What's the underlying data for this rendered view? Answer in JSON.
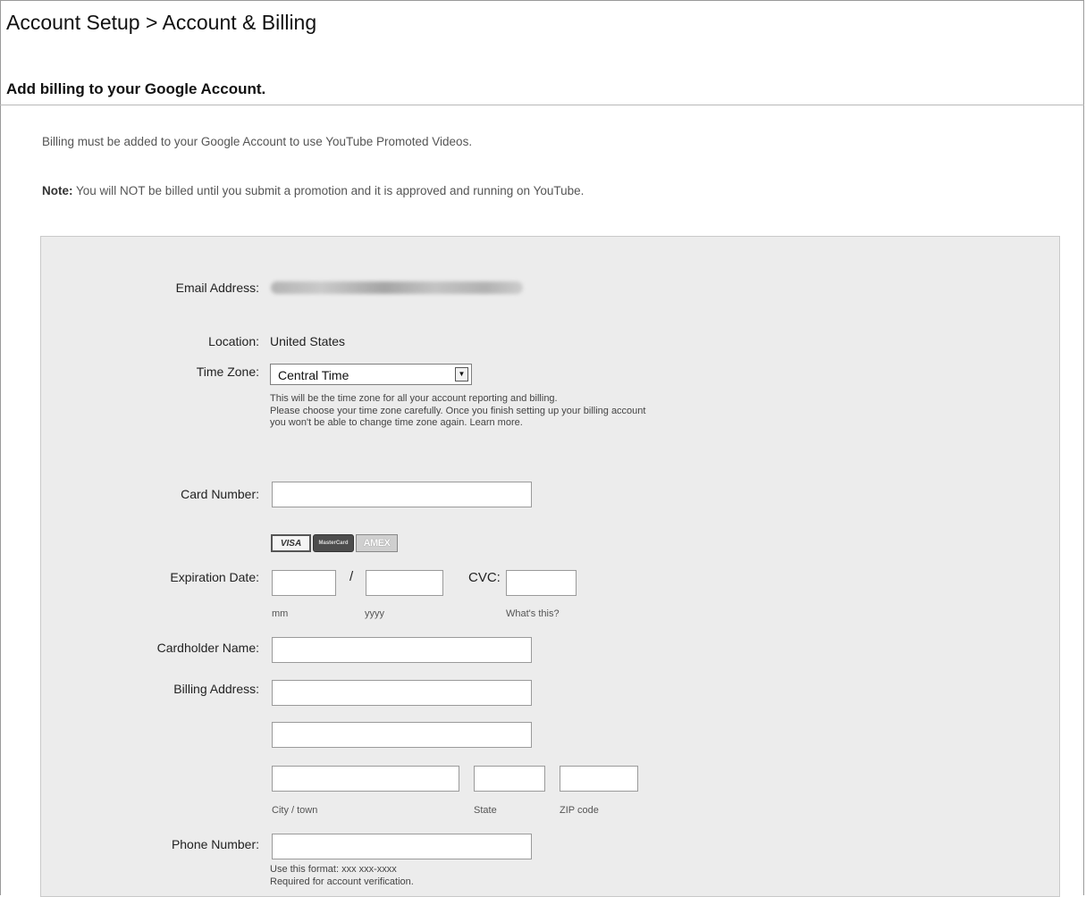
{
  "header": {
    "breadcrumb": "Account Setup > Account & Billing",
    "section_title": "Add billing to your Google Account."
  },
  "intro": {
    "text": "Billing must be added to your Google Account to use YouTube Promoted Videos.",
    "note_bold": "Note:",
    "note_text": " You will NOT be billed until you submit a promotion and it is approved and running on YouTube."
  },
  "form": {
    "email": {
      "label": "Email Address:"
    },
    "location": {
      "label": "Location:",
      "value": "United States"
    },
    "time_zone": {
      "label": "Time Zone:",
      "value": "Central Time",
      "help": [
        "This will be the time zone for all your account reporting and billing.",
        "Please choose your time zone carefully. Once you finish setting up your billing account",
        "you won't be able to change time zone again. Learn more."
      ]
    },
    "card_number": {
      "label": "Card Number:",
      "value": ""
    },
    "card_logos": [
      "VISA",
      "MasterCard",
      "AMEX"
    ],
    "expiration": {
      "label": "Expiration Date:",
      "separator": "/",
      "mm_hint": "mm",
      "yyyy_hint": "yyyy"
    },
    "cvc": {
      "label": "CVC:",
      "hint": "What's this?"
    },
    "cardholder": {
      "label": "Cardholder Name:"
    },
    "billing_address": {
      "label": "Billing Address:",
      "city_hint": "City / town",
      "state_hint": "State",
      "zip_hint": "ZIP code"
    },
    "phone": {
      "label": "Phone Number:",
      "help": [
        "Use this format: xxx xxx-xxxx",
        "Required for account verification."
      ]
    }
  }
}
